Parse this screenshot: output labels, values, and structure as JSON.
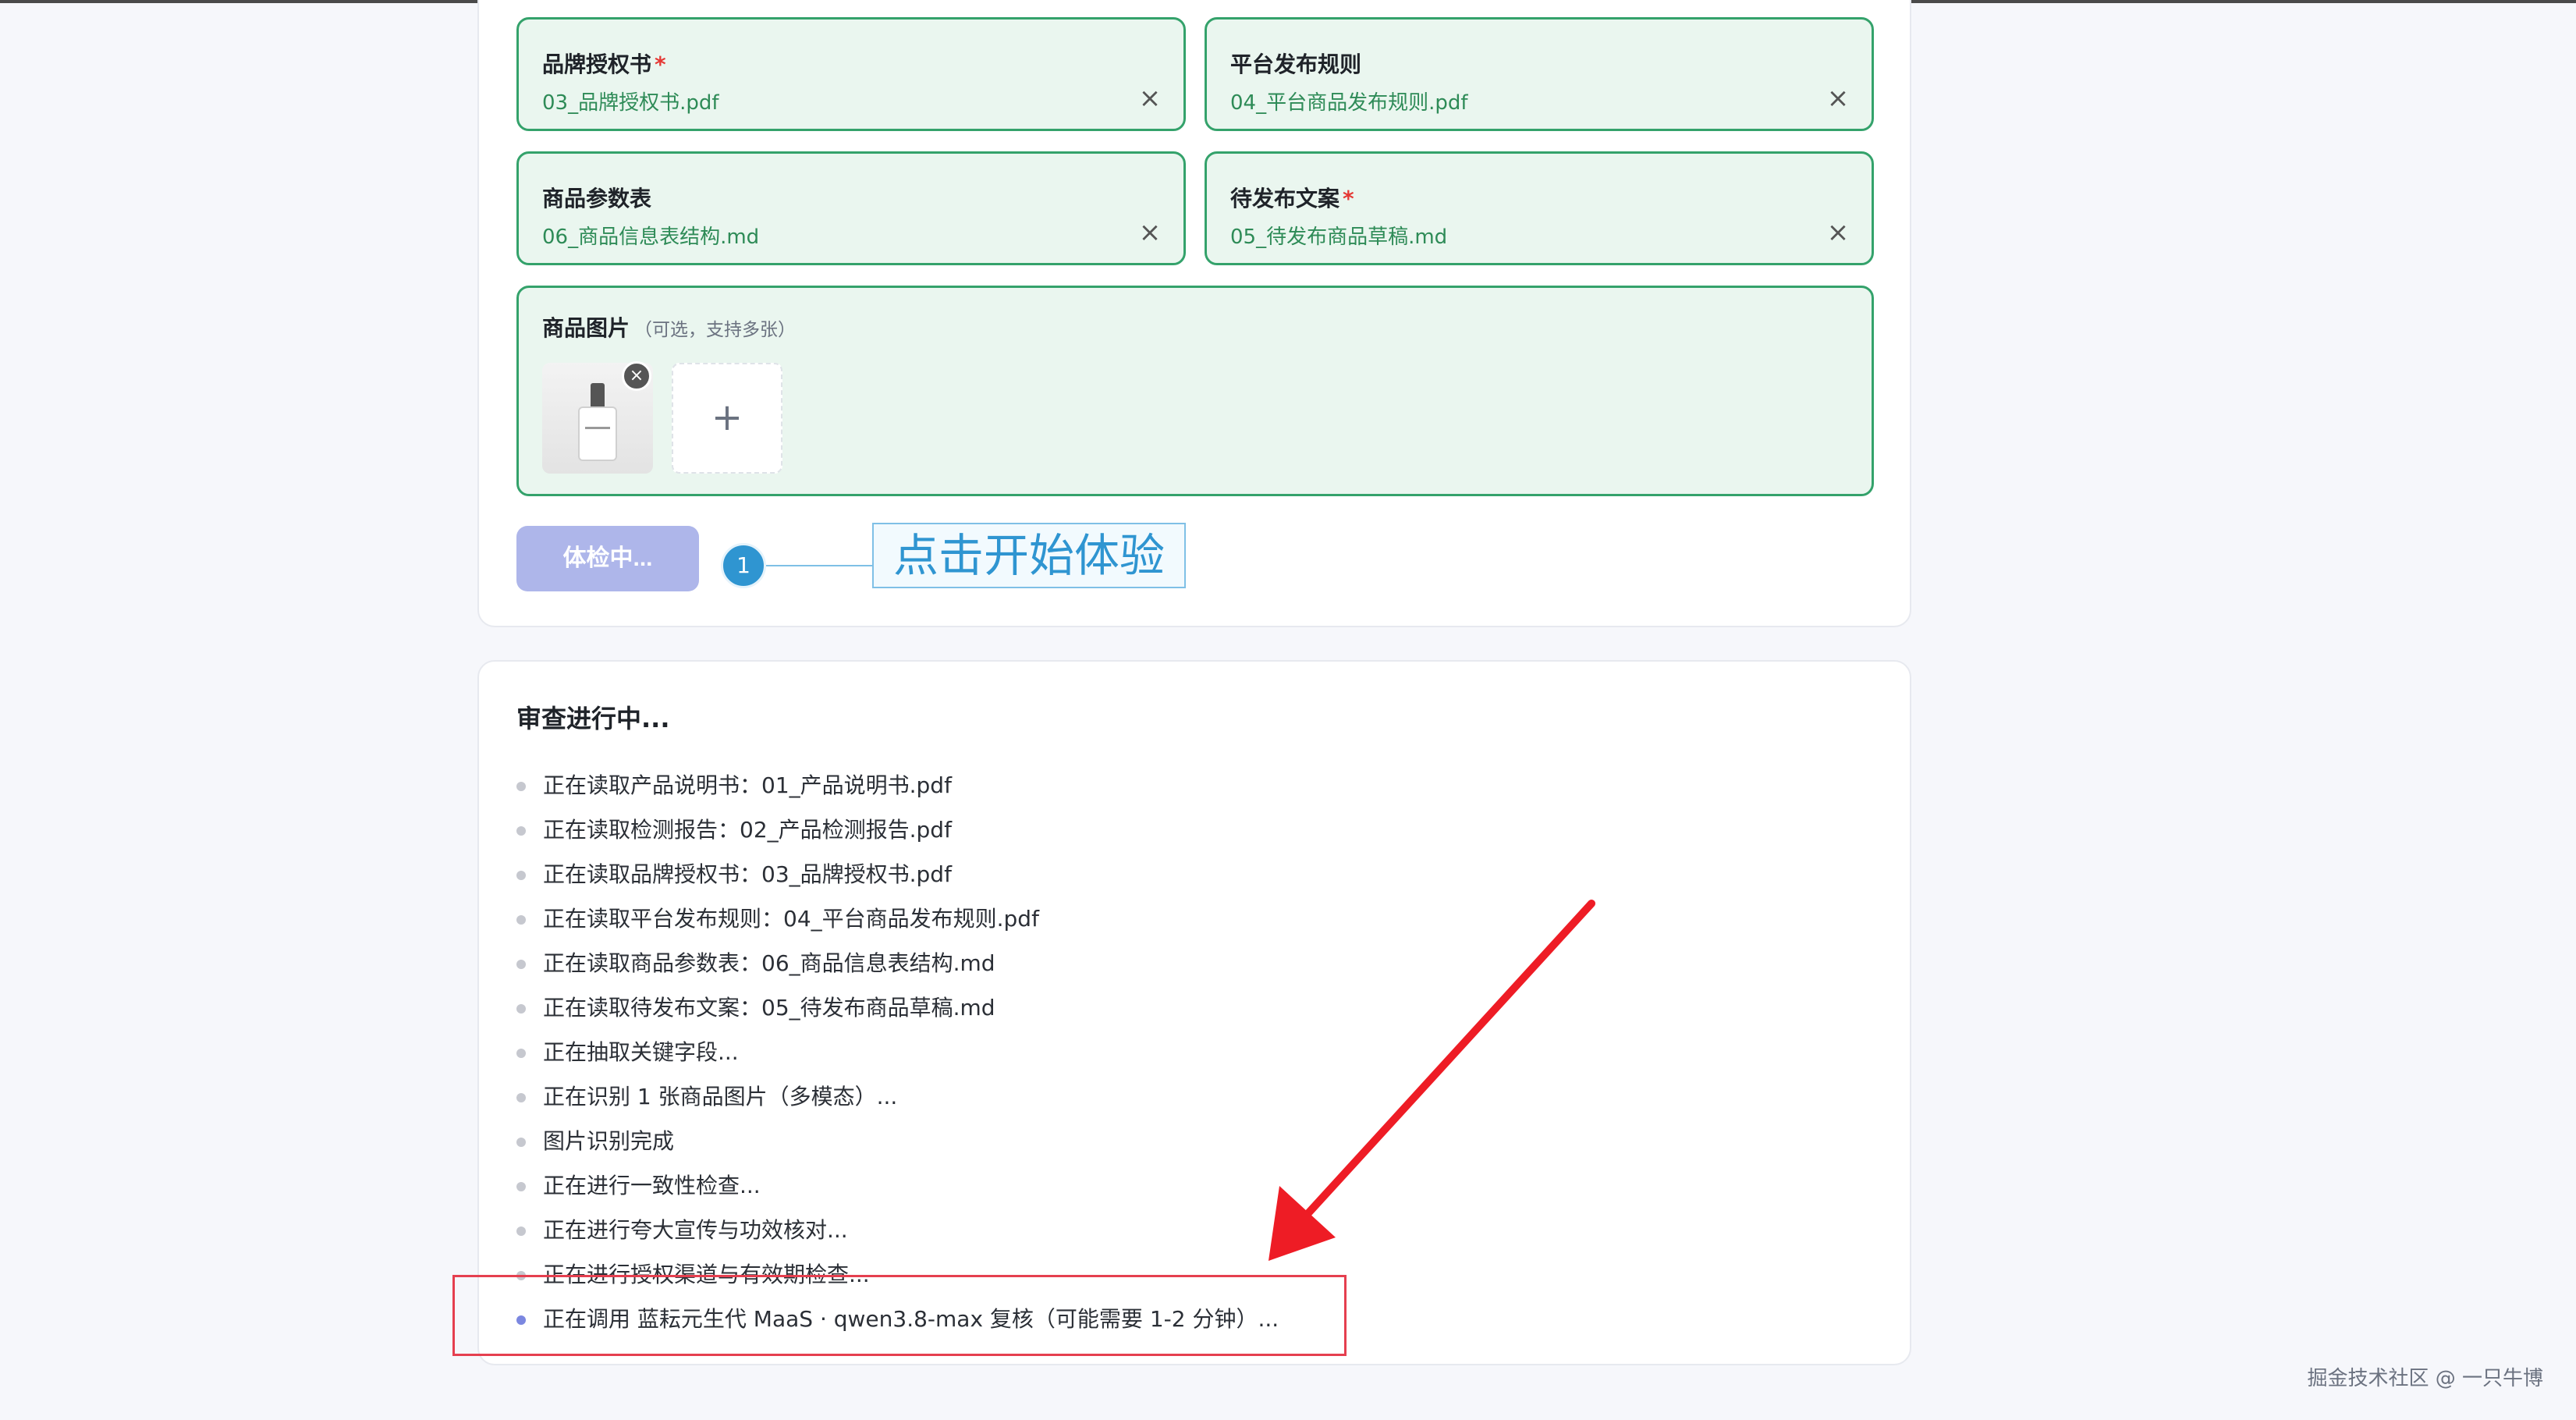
{
  "upload": {
    "fields": [
      {
        "label": "品牌授权书",
        "required": "*",
        "file": "03_品牌授权书.pdf"
      },
      {
        "label": "平台发布规则",
        "required": "",
        "file": "04_平台商品发布规则.pdf"
      },
      {
        "label": "商品参数表",
        "required": "",
        "file": "06_商品信息表结构.md"
      },
      {
        "label": "待发布文案",
        "required": "*",
        "file": "05_待发布商品草稿.md"
      }
    ],
    "close_glyph": "×",
    "images": {
      "label": "商品图片",
      "hint": "（可选，支持多张）",
      "delete_glyph": "×",
      "add_glyph": "+"
    },
    "check_button_label": "体检中...",
    "callout_step": "1",
    "callout_text": "点击开始体验"
  },
  "progress": {
    "title": "审查进行中...",
    "items": [
      "正在读取产品说明书：01_产品说明书.pdf",
      "正在读取检测报告：02_产品检测报告.pdf",
      "正在读取品牌授权书：03_品牌授权书.pdf",
      "正在读取平台发布规则：04_平台商品发布规则.pdf",
      "正在读取商品参数表：06_商品信息表结构.md",
      "正在读取待发布文案：05_待发布商品草稿.md",
      "正在抽取关键字段...",
      "正在识别 1 张商品图片（多模态）...",
      "图片识别完成",
      "正在进行一致性检查...",
      "正在进行夸大宣传与功效核对...",
      "正在进行授权渠道与有效期检查...",
      "正在调用 蓝耘元生代 MaaS · qwen3.8-max 复核（可能需要 1-2 分钟）..."
    ]
  },
  "watermark": "掘金技术社区 @ 一只牛博",
  "colors": {
    "accent_green": "#34a26b",
    "button_disabled": "#aeb6ea",
    "callout_blue": "#2f95d1",
    "annotation_red": "#e53f4f"
  }
}
